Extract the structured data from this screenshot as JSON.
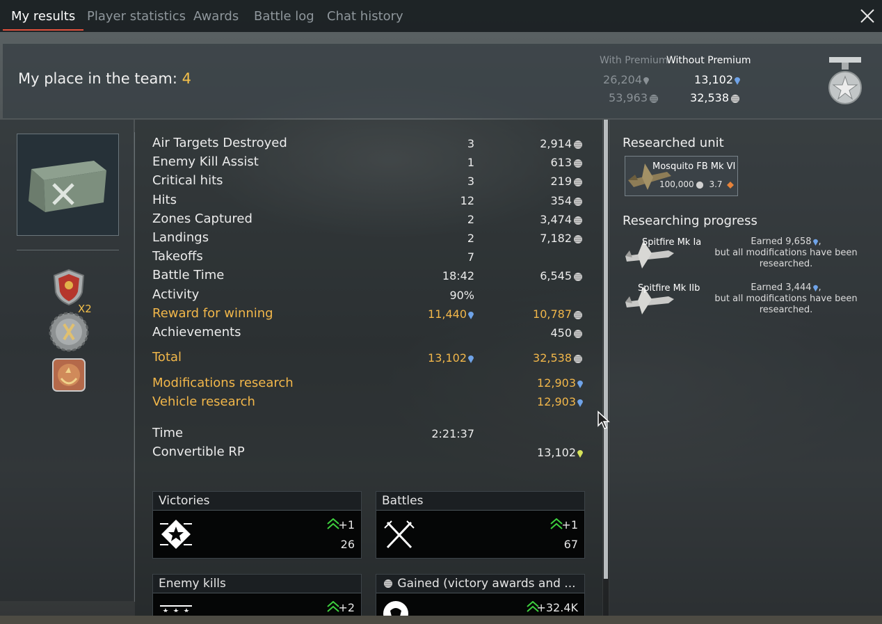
{
  "tabs": [
    {
      "label": "My results",
      "active": true
    },
    {
      "label": "Player statistics",
      "active": false
    },
    {
      "label": "Awards",
      "active": false
    },
    {
      "label": "Battle log",
      "active": false
    },
    {
      "label": "Chat history",
      "active": false
    }
  ],
  "header": {
    "place_label": "My place in the team:",
    "place_value": "4",
    "with_premium_label": "With Premium",
    "without_premium_label": "Without Premium",
    "with_premium_rp": "26,204",
    "with_premium_sl": "53,963",
    "without_premium_rp": "13,102",
    "without_premium_sl": "32,538"
  },
  "awards": {
    "multiplier": "X2"
  },
  "results": [
    {
      "label": "Air Targets Destroyed",
      "count": "3",
      "reward": "2,914",
      "reward_icon": "silver-lion-icon"
    },
    {
      "label": "Enemy Kill Assist",
      "count": "1",
      "reward": "613",
      "reward_icon": "silver-lion-icon"
    },
    {
      "label": "Critical hits",
      "count": "3",
      "reward": "219",
      "reward_icon": "silver-lion-icon"
    },
    {
      "label": "Hits",
      "count": "12",
      "reward": "354",
      "reward_icon": "silver-lion-icon"
    },
    {
      "label": "Zones Captured",
      "count": "2",
      "reward": "3,474",
      "reward_icon": "silver-lion-icon"
    },
    {
      "label": "Landings",
      "count": "2",
      "reward": "7,182",
      "reward_icon": "silver-lion-icon"
    },
    {
      "label": "Takeoffs",
      "count": "7",
      "reward": "",
      "reward_icon": ""
    },
    {
      "label": "Battle Time",
      "count": "18:42",
      "reward": "6,545",
      "reward_icon": "silver-lion-icon"
    },
    {
      "label": "Activity",
      "count": "90%",
      "reward": "",
      "reward_icon": ""
    },
    {
      "label": "Reward for winning",
      "count": "11,440",
      "count_icon": "research-point-icon",
      "reward": "10,787",
      "reward_icon": "silver-lion-icon",
      "highlight": true
    },
    {
      "label": "Achievements",
      "count": "",
      "reward": "450",
      "reward_icon": "silver-lion-icon"
    }
  ],
  "total": {
    "label": "Total",
    "rp": "13,102",
    "sl": "32,538"
  },
  "research": [
    {
      "label": "Modifications research",
      "value": "12,903"
    },
    {
      "label": "Vehicle research",
      "value": "12,903"
    }
  ],
  "time": {
    "label": "Time",
    "value": "2:21:37"
  },
  "convertible": {
    "label": "Convertible RP",
    "value": "13,102"
  },
  "stat_boxes": [
    {
      "title": "Victories",
      "delta": "+1",
      "total": "26",
      "icon": "victory-star-icon"
    },
    {
      "title": "Battles",
      "delta": "+1",
      "total": "67",
      "icon": "crossed-swords-icon"
    },
    {
      "title": "Enemy kills",
      "delta": "+2",
      "total": "",
      "icon": "kill-stars-icon"
    },
    {
      "title": "Gained (victory awards and ...",
      "delta": "+32.4K",
      "total": "",
      "icon": "lion-head-icon"
    }
  ],
  "researched_unit": {
    "title": "Researched unit",
    "name": "Mosquito FB Mk VI",
    "cost": "100,000",
    "br": "3.7"
  },
  "researching": {
    "title": "Researching progress",
    "items": [
      {
        "name": "Spitfire Mk Ia",
        "earned": "Earned 9,658",
        "note": "but all modifications have been researched."
      },
      {
        "name": "Spitfire Mk IIb",
        "earned": "Earned 3,444",
        "note": "but all modifications have been researched."
      }
    ]
  },
  "colors": {
    "gold": "#f2b74a",
    "rp_blue": "#6fa3e8",
    "convertible_yellow": "#d6e35a",
    "active_tab_underline": "#e0513c",
    "delta_green": "#3ecf3e"
  }
}
